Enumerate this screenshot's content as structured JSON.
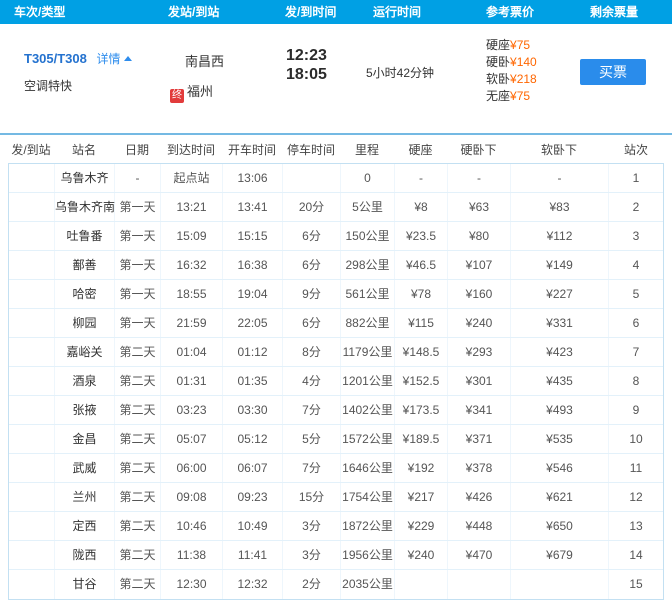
{
  "colors": {
    "topbar": "#00a0e4",
    "link_blue": "#2e8ded",
    "train_number_blue": "#2472cf",
    "price_orange": "#ff6600",
    "buy_button_blue": "#2a8ceb",
    "terminal_badge_red": "#e23b3b"
  },
  "header": {
    "columns": [
      "车次/类型",
      "发站/到站",
      "发/到时间",
      "运行时间",
      "参考票价",
      "剩余票量"
    ]
  },
  "train": {
    "number": "T305/T308",
    "details_label": "详情",
    "type": "空调特快",
    "from_station": "南昌西",
    "to_badge": "终",
    "to_station": "福州",
    "depart_time": "12:23",
    "arrive_time": "18:05",
    "duration": "5小时42分钟",
    "prices": [
      {
        "label": "硬座",
        "value": "¥75"
      },
      {
        "label": "硬卧",
        "value": "¥140"
      },
      {
        "label": "软卧",
        "value": "¥218"
      },
      {
        "label": "无座",
        "value": "¥75"
      }
    ],
    "buy_label": "买票"
  },
  "table": {
    "columns": [
      "发/到站",
      "站名",
      "日期",
      "到达时间",
      "开车时间",
      "停车时间",
      "里程",
      "硬座",
      "硬卧下",
      "软卧下",
      "站次"
    ],
    "rows": [
      [
        "",
        "乌鲁木齐",
        "-",
        "起点站",
        "13:06",
        "",
        "0",
        "-",
        "-",
        "-",
        "1"
      ],
      [
        "",
        "乌鲁木齐南",
        "第一天",
        "13:21",
        "13:41",
        "20分",
        "5公里",
        "¥8",
        "¥63",
        "¥83",
        "2"
      ],
      [
        "",
        "吐鲁番",
        "第一天",
        "15:09",
        "15:15",
        "6分",
        "150公里",
        "¥23.5",
        "¥80",
        "¥112",
        "3"
      ],
      [
        "",
        "鄯善",
        "第一天",
        "16:32",
        "16:38",
        "6分",
        "298公里",
        "¥46.5",
        "¥107",
        "¥149",
        "4"
      ],
      [
        "",
        "哈密",
        "第一天",
        "18:55",
        "19:04",
        "9分",
        "561公里",
        "¥78",
        "¥160",
        "¥227",
        "5"
      ],
      [
        "",
        "柳园",
        "第一天",
        "21:59",
        "22:05",
        "6分",
        "882公里",
        "¥115",
        "¥240",
        "¥331",
        "6"
      ],
      [
        "",
        "嘉峪关",
        "第二天",
        "01:04",
        "01:12",
        "8分",
        "1179公里",
        "¥148.5",
        "¥293",
        "¥423",
        "7"
      ],
      [
        "",
        "酒泉",
        "第二天",
        "01:31",
        "01:35",
        "4分",
        "1201公里",
        "¥152.5",
        "¥301",
        "¥435",
        "8"
      ],
      [
        "",
        "张掖",
        "第二天",
        "03:23",
        "03:30",
        "7分",
        "1402公里",
        "¥173.5",
        "¥341",
        "¥493",
        "9"
      ],
      [
        "",
        "金昌",
        "第二天",
        "05:07",
        "05:12",
        "5分",
        "1572公里",
        "¥189.5",
        "¥371",
        "¥535",
        "10"
      ],
      [
        "",
        "武威",
        "第二天",
        "06:00",
        "06:07",
        "7分",
        "1646公里",
        "¥192",
        "¥378",
        "¥546",
        "11"
      ],
      [
        "",
        "兰州",
        "第二天",
        "09:08",
        "09:23",
        "15分",
        "1754公里",
        "¥217",
        "¥426",
        "¥621",
        "12"
      ],
      [
        "",
        "定西",
        "第二天",
        "10:46",
        "10:49",
        "3分",
        "1872公里",
        "¥229",
        "¥448",
        "¥650",
        "13"
      ],
      [
        "",
        "陇西",
        "第二天",
        "11:38",
        "11:41",
        "3分",
        "1956公里",
        "¥240",
        "¥470",
        "¥679",
        "14"
      ],
      [
        "",
        "甘谷",
        "第二天",
        "12:30",
        "12:32",
        "2分",
        "2035公里",
        "",
        "",
        "",
        "15"
      ]
    ]
  }
}
